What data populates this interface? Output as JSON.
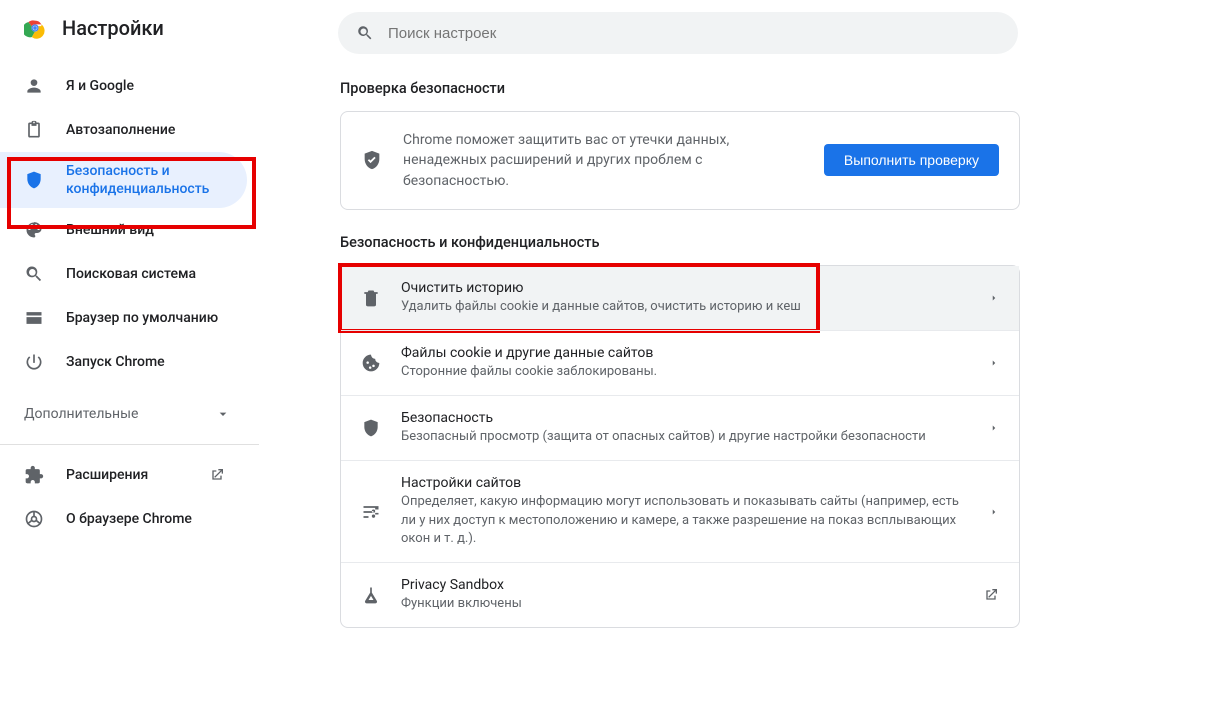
{
  "brand": {
    "title": "Настройки"
  },
  "search": {
    "placeholder": "Поиск настроек"
  },
  "sidebar": {
    "items": [
      {
        "label": "Я и Google"
      },
      {
        "label": "Автозаполнение"
      },
      {
        "label": "Безопасность и конфиденциальность"
      },
      {
        "label": "Внешний вид"
      },
      {
        "label": "Поисковая система"
      },
      {
        "label": "Браузер по умолчанию"
      },
      {
        "label": "Запуск Chrome"
      }
    ],
    "advanced_label": "Дополнительные",
    "footer": [
      {
        "label": "Расширения"
      },
      {
        "label": "О браузере Chrome"
      }
    ]
  },
  "sections": {
    "safety_check": {
      "title": "Проверка безопасности",
      "description": "Chrome поможет защитить вас от утечки данных, ненадежных расширений и других проблем с безопасностью.",
      "button": "Выполнить проверку"
    },
    "privacy": {
      "title": "Безопасность и конфиденциальность",
      "rows": [
        {
          "title": "Очистить историю",
          "sub": "Удалить файлы cookie и данные сайтов, очистить историю и кеш",
          "icon": "trash",
          "trailing": "arrow",
          "hovered": true,
          "highlight": true
        },
        {
          "title": "Файлы cookie и другие данные сайтов",
          "sub": "Сторонние файлы cookie заблокированы.",
          "icon": "cookie",
          "trailing": "arrow"
        },
        {
          "title": "Безопасность",
          "sub": "Безопасный просмотр (защита от опасных сайтов) и другие настройки безопасности",
          "icon": "shield",
          "trailing": "arrow"
        },
        {
          "title": "Настройки сайтов",
          "sub": "Определяет, какую информацию могут использовать и показывать сайты (например, есть ли у них доступ к местоположению и камере, а также разрешение на показ всплывающих окон и т. д.).",
          "icon": "tune",
          "trailing": "arrow"
        },
        {
          "title": "Privacy Sandbox",
          "sub": "Функции включены",
          "icon": "flask",
          "trailing": "external"
        }
      ]
    }
  }
}
